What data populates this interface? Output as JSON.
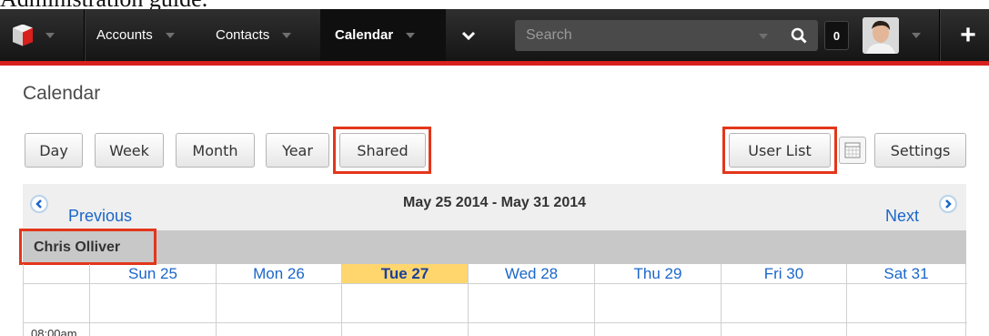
{
  "caption": "Administration guide.",
  "nav": {
    "items": [
      {
        "label": "Accounts"
      },
      {
        "label": "Contacts"
      },
      {
        "label": "Calendar"
      }
    ],
    "search_placeholder": "Search",
    "notification_count": "0",
    "quick_create_label": "+"
  },
  "page": {
    "title": "Calendar"
  },
  "views": {
    "day": "Day",
    "week": "Week",
    "month": "Month",
    "year": "Year",
    "shared": "Shared",
    "user_list": "User List",
    "settings": "Settings"
  },
  "calendar_nav": {
    "previous": "Previous",
    "range": "May 25 2014 - May 31 2014",
    "next": "Next"
  },
  "shared_user": "Chris Olliver",
  "days": [
    {
      "label": "Sun 25"
    },
    {
      "label": "Mon 26"
    },
    {
      "label": "Tue 27"
    },
    {
      "label": "Wed 28"
    },
    {
      "label": "Thu 29"
    },
    {
      "label": "Fri 30"
    },
    {
      "label": "Sat 31"
    }
  ],
  "time_slot": "08:00am",
  "colors": {
    "accent_red": "#d8201d",
    "highlight_red": "#e3361b",
    "link_blue": "#1b66c9",
    "today_bg": "#ffd66e"
  },
  "icons": [
    "sugar-logo-icon",
    "chevron-down-icon",
    "search-icon",
    "calendar-grid-icon",
    "chevron-left-icon",
    "chevron-right-icon",
    "plus-icon"
  ]
}
